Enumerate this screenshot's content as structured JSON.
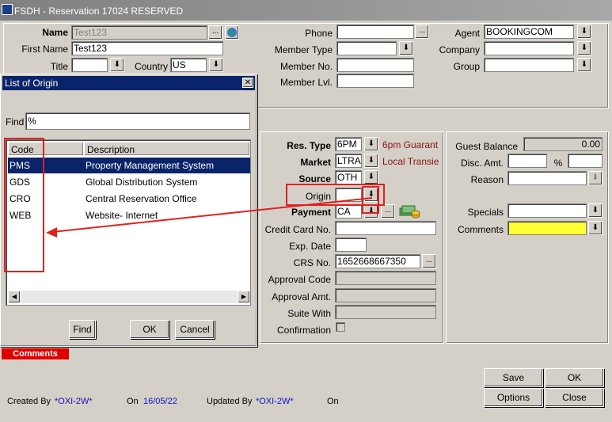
{
  "window": {
    "title": "FSDH - Reservation 17024  RESERVED"
  },
  "guest": {
    "name_label": "Name",
    "name_value": "Test123",
    "first_name_label": "First Name",
    "first_name_value": "Test123",
    "title_label": "Title",
    "title_value": "",
    "country_label": "Country",
    "country_value": "US"
  },
  "contact": {
    "phone_label": "Phone",
    "phone_value": "",
    "member_type_label": "Member Type",
    "member_type_value": "",
    "member_no_label": "Member No.",
    "member_no_value": "",
    "member_lvl_label": "Member Lvl.",
    "member_lvl_value": ""
  },
  "agent": {
    "agent_label": "Agent",
    "agent_value": "BOOKINGCOM",
    "company_label": "Company",
    "company_value": "",
    "group_label": "Group",
    "group_value": ""
  },
  "dialog": {
    "title": "List of Origin",
    "find_label": "Find",
    "find_value": "%",
    "col_code": "Code",
    "col_description": "Description",
    "rows": [
      {
        "code": "PMS",
        "description": "Property Management System",
        "selected": true
      },
      {
        "code": "GDS",
        "description": "Global Distribution System",
        "selected": false
      },
      {
        "code": "CRO",
        "description": "Central Reservation Office",
        "selected": false
      },
      {
        "code": "WEB",
        "description": "Website- Internet",
        "selected": false
      }
    ],
    "find_button": "Find",
    "ok_button": "OK",
    "cancel_button": "Cancel"
  },
  "reservation": {
    "res_type_label": "Res. Type",
    "res_type_value": "6PM",
    "res_type_desc": "6pm Guarant",
    "market_label": "Market",
    "market_value": "LTRAN",
    "market_desc": "Local Transie",
    "source_label": "Source",
    "source_value": "OTH",
    "origin_label": "Origin",
    "origin_value": "",
    "payment_label": "Payment",
    "payment_value": "CA",
    "credit_card_label": "Credit Card No.",
    "credit_card_value": "",
    "exp_date_label": "Exp. Date",
    "exp_date_value": "",
    "crs_no_label": "CRS No.",
    "crs_no_value": "1652668667350",
    "approval_code_label": "Approval Code",
    "approval_code_value": "",
    "approval_amt_label": "Approval Amt.",
    "approval_amt_value": "",
    "suite_with_label": "Suite With",
    "suite_with_value": "",
    "confirmation_label": "Confirmation",
    "confirmation_checked": false
  },
  "balance": {
    "guest_balance_label": "Guest Balance",
    "guest_balance_value": "0.00",
    "disc_amt_label": "Disc. Amt.",
    "disc_amt_value": "",
    "percent_symbol": "%",
    "disc_pct_value": "",
    "reason_label": "Reason",
    "reason_value": "",
    "specials_label": "Specials",
    "specials_value": "",
    "comments_label": "Comments",
    "comments_value": ""
  },
  "comments_tab": "Comments",
  "buttons": {
    "save": "Save",
    "ok": "OK",
    "options": "Options",
    "close": "Close"
  },
  "footer": {
    "created_by_label": "Created By",
    "created_by_value": "*OXI-2W*",
    "created_on_label": "On",
    "created_on_value": "16/05/22",
    "updated_by_label": "Updated By",
    "updated_by_value": "*OXI-2W*",
    "updated_on_label": "On",
    "updated_on_value": ""
  },
  "colors": {
    "highlight": "#0a246a",
    "annotation": "#e02020",
    "comments_bar": "#e00000",
    "comments_field": "#ffff33"
  },
  "icons": {
    "dropdown": "arrow-down-icon",
    "lookup": "ellipsis-icon",
    "globe": "globe-icon",
    "money": "money-icon"
  }
}
